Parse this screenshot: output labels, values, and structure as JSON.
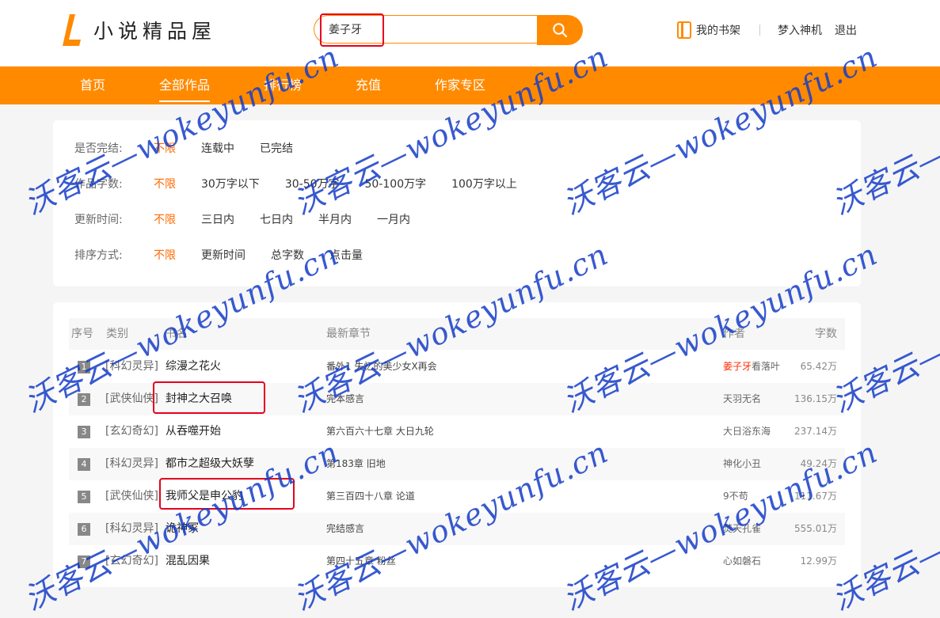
{
  "logo": {
    "text": "小说精品屋"
  },
  "search": {
    "value": "姜子牙",
    "icon": "search-icon"
  },
  "top_links": {
    "bookshelf": "我的书架",
    "username": "梦入神机",
    "logout": "退出"
  },
  "nav": [
    {
      "label": "首页",
      "active": false
    },
    {
      "label": "全部作品",
      "active": true
    },
    {
      "label": "排行榜",
      "active": false
    },
    {
      "label": "充值",
      "active": false
    },
    {
      "label": "作家专区",
      "active": false
    }
  ],
  "filters": [
    {
      "label": "是否完结:",
      "options": [
        "不限",
        "连载中",
        "已完结"
      ]
    },
    {
      "label": "作品字数:",
      "options": [
        "不限",
        "30万字以下",
        "30-50万字",
        "50-100万字",
        "100万字以上"
      ]
    },
    {
      "label": "更新时间:",
      "options": [
        "不限",
        "三日内",
        "七日内",
        "半月内",
        "一月内"
      ]
    },
    {
      "label": "排序方式:",
      "options": [
        "不限",
        "更新时间",
        "总字数",
        "点击量"
      ]
    }
  ],
  "table": {
    "headers": {
      "rank": "序号",
      "category": "类别",
      "title": "书名",
      "chapter": "最新章节",
      "author": "作者",
      "words": "字数"
    },
    "rows": [
      {
        "rank": "1",
        "category": "[科幻灵异]",
        "title": "综漫之花火",
        "chapter": "番外1 失忆的美少女X再会",
        "author_hl": "姜子牙",
        "author": "看落叶",
        "words": "65.42万"
      },
      {
        "rank": "2",
        "category": "[武侠仙侠]",
        "title": "封神之大召唤",
        "chapter": "完本感言",
        "author_hl": "",
        "author": "天羽无名",
        "words": "136.15万"
      },
      {
        "rank": "3",
        "category": "[玄幻奇幻]",
        "title": "从吞噬开始",
        "chapter": "第六百六十七章 大日九轮",
        "author_hl": "",
        "author": "大日浴东海",
        "words": "237.14万"
      },
      {
        "rank": "4",
        "category": "[科幻灵异]",
        "title": "都市之超级大妖孽",
        "chapter": "第183章 旧地",
        "author_hl": "",
        "author": "神化小丑",
        "words": "49.24万"
      },
      {
        "rank": "5",
        "category": "[武侠仙侠]",
        "title": "我师父是申公豹",
        "chapter": "第三百四十八章 论道",
        "author_hl": "",
        "author": "9不苟",
        "words": "111.67万"
      },
      {
        "rank": "6",
        "category": "[科幻灵异]",
        "title": "诡神冢",
        "chapter": "完结感言",
        "author_hl": "",
        "author": "焚天孔雀",
        "words": "555.01万"
      },
      {
        "rank": "7",
        "category": "[玄幻奇幻]",
        "title": "混乱因果",
        "chapter": "第四十五章 粉丝",
        "author_hl": "",
        "author": "心如磐石",
        "words": "12.99万"
      }
    ]
  },
  "watermark": {
    "text": "沃客云—wokeyunfu.cn",
    "color": "#143cc8"
  },
  "colors": {
    "accent": "#ff8a00",
    "selected": "#ff6a00",
    "highlight_box": "#e5001f"
  }
}
